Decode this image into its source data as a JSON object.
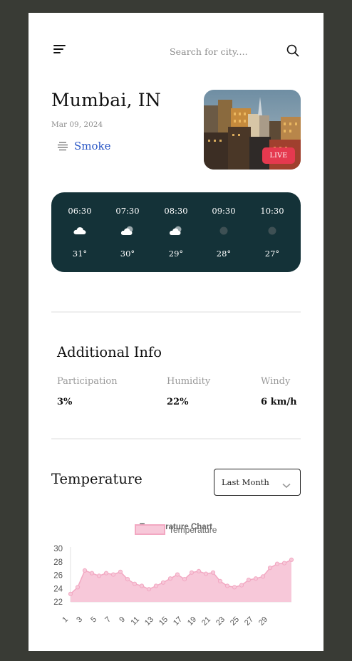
{
  "search": {
    "placeholder": "Search for city...."
  },
  "location": {
    "city": "Mumbai, IN",
    "date": "Mar 09, 2024",
    "condition": "Smoke",
    "condition_icon": "haze-icon"
  },
  "live": {
    "badge": "LIVE"
  },
  "hourly": [
    {
      "time": "06:30",
      "icon": "cloud-icon",
      "temp": "31°"
    },
    {
      "time": "07:30",
      "icon": "partly-cloudy-icon",
      "temp": "30°"
    },
    {
      "time": "08:30",
      "icon": "partly-cloudy-icon",
      "temp": "29°"
    },
    {
      "time": "09:30",
      "icon": "night-icon",
      "temp": "28°"
    },
    {
      "time": "10:30",
      "icon": "night-icon",
      "temp": "27°"
    }
  ],
  "additional_info": {
    "title": "Additional Info",
    "items": [
      {
        "label": "Participation",
        "value": "3%"
      },
      {
        "label": "Humidity",
        "value": "22%"
      },
      {
        "label": "Windy",
        "value": "6 km/h"
      }
    ]
  },
  "temperature": {
    "title": "Temperature",
    "period": "Last Month"
  },
  "colors": {
    "accent_dark": "#143238",
    "live_red": "#e5394f",
    "link_blue": "#2855c5",
    "series_fill": "#f7c8d9",
    "series_stroke": "#f2a8c2"
  },
  "chart_data": {
    "type": "area",
    "title": "Temperature Chart",
    "legend": "top",
    "series": [
      {
        "name": "Temperature",
        "values": [
          23.2,
          24.2,
          26.7,
          26.3,
          25.9,
          26.3,
          26.1,
          26.5,
          25.4,
          24.7,
          24.4,
          23.9,
          24.4,
          24.9,
          25.5,
          26.1,
          25.4,
          26.4,
          26.6,
          26.2,
          26.4,
          25.1,
          24.4,
          24.2,
          24.5,
          25.3,
          25.5,
          25.8,
          27.1,
          27.7,
          27.8,
          28.3
        ]
      }
    ],
    "x": [
      1,
      2,
      3,
      4,
      5,
      6,
      7,
      8,
      9,
      10,
      11,
      12,
      13,
      14,
      15,
      16,
      17,
      18,
      19,
      20,
      21,
      22,
      23,
      24,
      25,
      26,
      27,
      28,
      29,
      30,
      31,
      32
    ],
    "xticks": [
      "1",
      "3",
      "5",
      "7",
      "9",
      "11",
      "13",
      "15",
      "17",
      "19",
      "21",
      "23",
      "25",
      "27",
      "29"
    ],
    "yticks": [
      "30",
      "28",
      "26",
      "24",
      "22"
    ],
    "ylim": [
      22,
      30
    ],
    "grid": false
  }
}
